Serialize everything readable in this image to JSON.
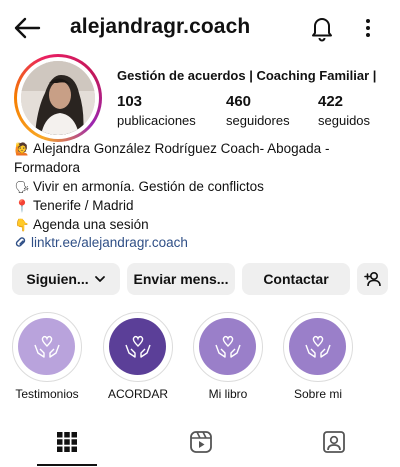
{
  "header": {
    "username": "alejandragr.coach",
    "icons": {
      "back": "arrow-left-icon",
      "notifications": "bell-icon",
      "more": "more-vertical-icon"
    }
  },
  "profile": {
    "display_line": "Gestión de acuerdos | Coaching Familiar |",
    "stats": [
      {
        "value": "103",
        "label": "publicaciones"
      },
      {
        "value": "460",
        "label": "seguidores"
      },
      {
        "value": "422",
        "label": "seguidos"
      }
    ]
  },
  "bio": {
    "line1": "Alejandra González Rodríguez Coach- Abogada -",
    "line2": "Formadora",
    "line3": "Vivir en armonía. Gestión de conflictos",
    "line4": "Tenerife / Madrid",
    "line5": "Agenda una sesión",
    "link": "linktr.ee/alejandragr.coach",
    "emoji": {
      "line1": "🙋",
      "line3": "🗣",
      "line4": "📍",
      "line5": "👇"
    }
  },
  "actions": {
    "following": "Siguien...",
    "message": "Enviar mens...",
    "contact": "Contactar"
  },
  "highlights": [
    {
      "label": "Testimonios"
    },
    {
      "label": "ACORDAR"
    },
    {
      "label": "Mi libro"
    },
    {
      "label": "Sobre mi"
    }
  ],
  "colors": {
    "highlight_light": "#b9a3dc",
    "highlight_dark": "#5b3f98",
    "highlight_mid": "#9a7fc9",
    "link": "#2f4f86",
    "button_bg": "#efefef"
  },
  "tabs": [
    {
      "icon": "grid-icon",
      "active": true
    },
    {
      "icon": "reels-icon",
      "active": false
    },
    {
      "icon": "tagged-icon",
      "active": false
    }
  ]
}
